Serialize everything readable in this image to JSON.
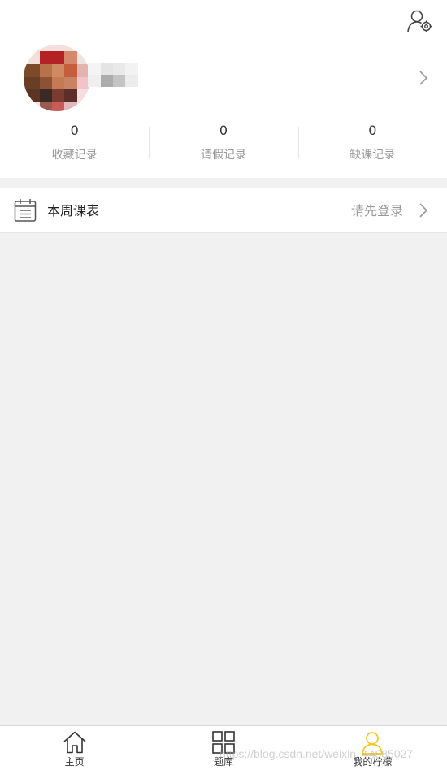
{
  "profile": {
    "settings_icon": "user-settings-icon",
    "avatar_alt": "pixelated-avatar",
    "stats": [
      {
        "value": "0",
        "label": "收藏记录"
      },
      {
        "value": "0",
        "label": "请假记录"
      },
      {
        "value": "0",
        "label": "缺课记录"
      }
    ]
  },
  "schedule": {
    "icon": "calendar-icon",
    "title": "本周课表",
    "status": "请先登录"
  },
  "tabbar": {
    "items": [
      {
        "label": "主页",
        "icon": "home-icon",
        "active": false
      },
      {
        "label": "题库",
        "icon": "grid-icon",
        "active": false
      },
      {
        "label": "我的柠檬",
        "icon": "user-icon",
        "active": true
      }
    ]
  },
  "watermark": "https://blog.csdn.net/weixin_44885027",
  "colors": {
    "accent": "#f5c518",
    "background": "#f1f1f1",
    "text_muted": "#999999"
  }
}
